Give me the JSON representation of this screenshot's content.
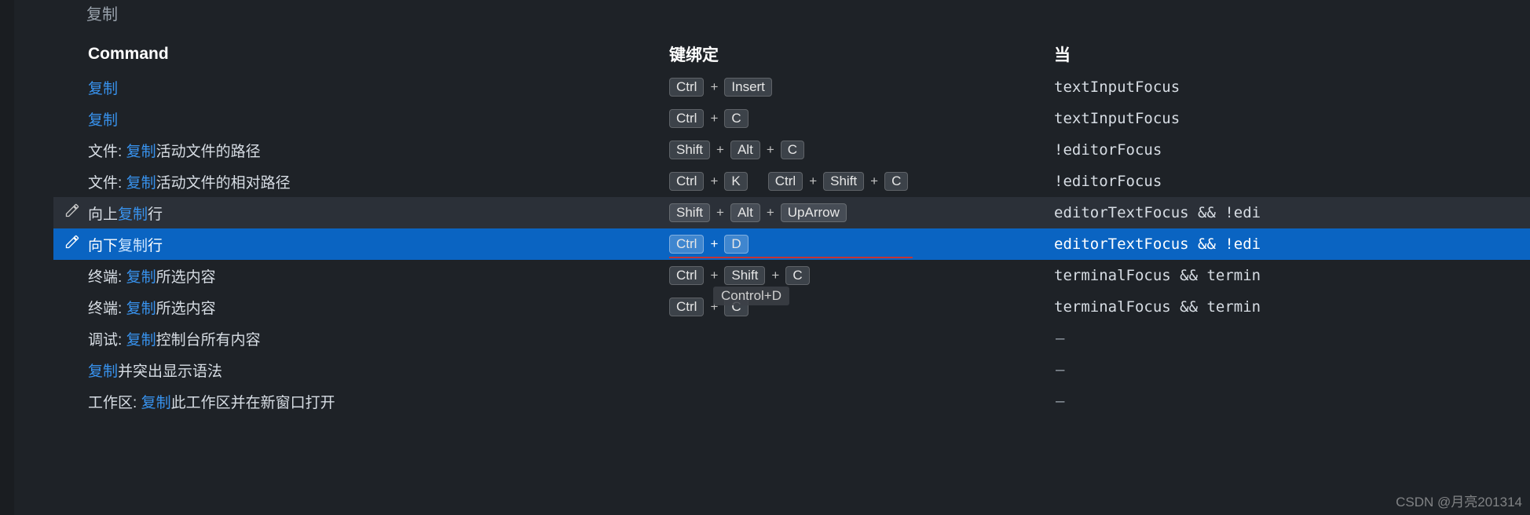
{
  "search_label": "复制",
  "headers": {
    "command": "Command",
    "keybinding": "键绑定",
    "when": "当"
  },
  "tooltip": "Control+D",
  "watermark": "CSDN @月亮201314",
  "dash": "—",
  "rows": [
    {
      "edit": false,
      "selected": false,
      "hovered": false,
      "cmd_parts": [
        {
          "t": "复制",
          "hl": true
        }
      ],
      "keys": [
        [
          "Ctrl",
          "Insert"
        ]
      ],
      "when": "textInputFocus"
    },
    {
      "edit": false,
      "selected": false,
      "hovered": false,
      "cmd_parts": [
        {
          "t": "复制",
          "hl": true
        }
      ],
      "keys": [
        [
          "Ctrl",
          "C"
        ]
      ],
      "when": "textInputFocus"
    },
    {
      "edit": false,
      "selected": false,
      "hovered": false,
      "cmd_parts": [
        {
          "t": "文件: ",
          "hl": false
        },
        {
          "t": "复制",
          "hl": true
        },
        {
          "t": "活动文件的路径",
          "hl": false
        }
      ],
      "keys": [
        [
          "Shift",
          "Alt",
          "C"
        ]
      ],
      "when": "!editorFocus"
    },
    {
      "edit": false,
      "selected": false,
      "hovered": false,
      "cmd_parts": [
        {
          "t": "文件: ",
          "hl": false
        },
        {
          "t": "复制",
          "hl": true
        },
        {
          "t": "活动文件的相对路径",
          "hl": false
        }
      ],
      "keys": [
        [
          "Ctrl",
          "K"
        ],
        [
          "Ctrl",
          "Shift",
          "C"
        ]
      ],
      "when": "!editorFocus"
    },
    {
      "edit": true,
      "selected": false,
      "hovered": true,
      "cmd_parts": [
        {
          "t": "向上",
          "hl": false
        },
        {
          "t": "复制",
          "hl": true
        },
        {
          "t": "行",
          "hl": false
        }
      ],
      "keys": [
        [
          "Shift",
          "Alt",
          "UpArrow"
        ]
      ],
      "when": "editorTextFocus && !edi"
    },
    {
      "edit": true,
      "selected": true,
      "hovered": false,
      "underline": true,
      "cmd_parts": [
        {
          "t": "向下",
          "hl": false
        },
        {
          "t": "复制",
          "hl": true
        },
        {
          "t": "行",
          "hl": false
        }
      ],
      "keys": [
        [
          "Ctrl",
          "D"
        ]
      ],
      "when": "editorTextFocus && !edi"
    },
    {
      "edit": false,
      "selected": false,
      "hovered": false,
      "tooltip": true,
      "cmd_parts": [
        {
          "t": "终端: ",
          "hl": false
        },
        {
          "t": "复制",
          "hl": true
        },
        {
          "t": "所选内容",
          "hl": false
        }
      ],
      "keys": [
        [
          "Ctrl",
          "Shift",
          "C"
        ]
      ],
      "when": "terminalFocus && termin"
    },
    {
      "edit": false,
      "selected": false,
      "hovered": false,
      "cmd_parts": [
        {
          "t": "终端: ",
          "hl": false
        },
        {
          "t": "复制",
          "hl": true
        },
        {
          "t": "所选内容",
          "hl": false
        }
      ],
      "keys": [
        [
          "Ctrl",
          "C"
        ]
      ],
      "when": "terminalFocus && termin"
    },
    {
      "edit": false,
      "selected": false,
      "hovered": false,
      "cmd_parts": [
        {
          "t": "调试: ",
          "hl": false
        },
        {
          "t": "复制",
          "hl": true
        },
        {
          "t": "控制台所有内容",
          "hl": false
        }
      ],
      "keys": [],
      "when": null
    },
    {
      "edit": false,
      "selected": false,
      "hovered": false,
      "cmd_parts": [
        {
          "t": "复制",
          "hl": true
        },
        {
          "t": "并突出显示语法",
          "hl": false
        }
      ],
      "keys": [],
      "when": null
    },
    {
      "edit": false,
      "selected": false,
      "hovered": false,
      "cmd_parts": [
        {
          "t": "工作区: ",
          "hl": false
        },
        {
          "t": "复制",
          "hl": true
        },
        {
          "t": "此工作区并在新窗口打开",
          "hl": false
        }
      ],
      "keys": [],
      "when": null
    }
  ]
}
